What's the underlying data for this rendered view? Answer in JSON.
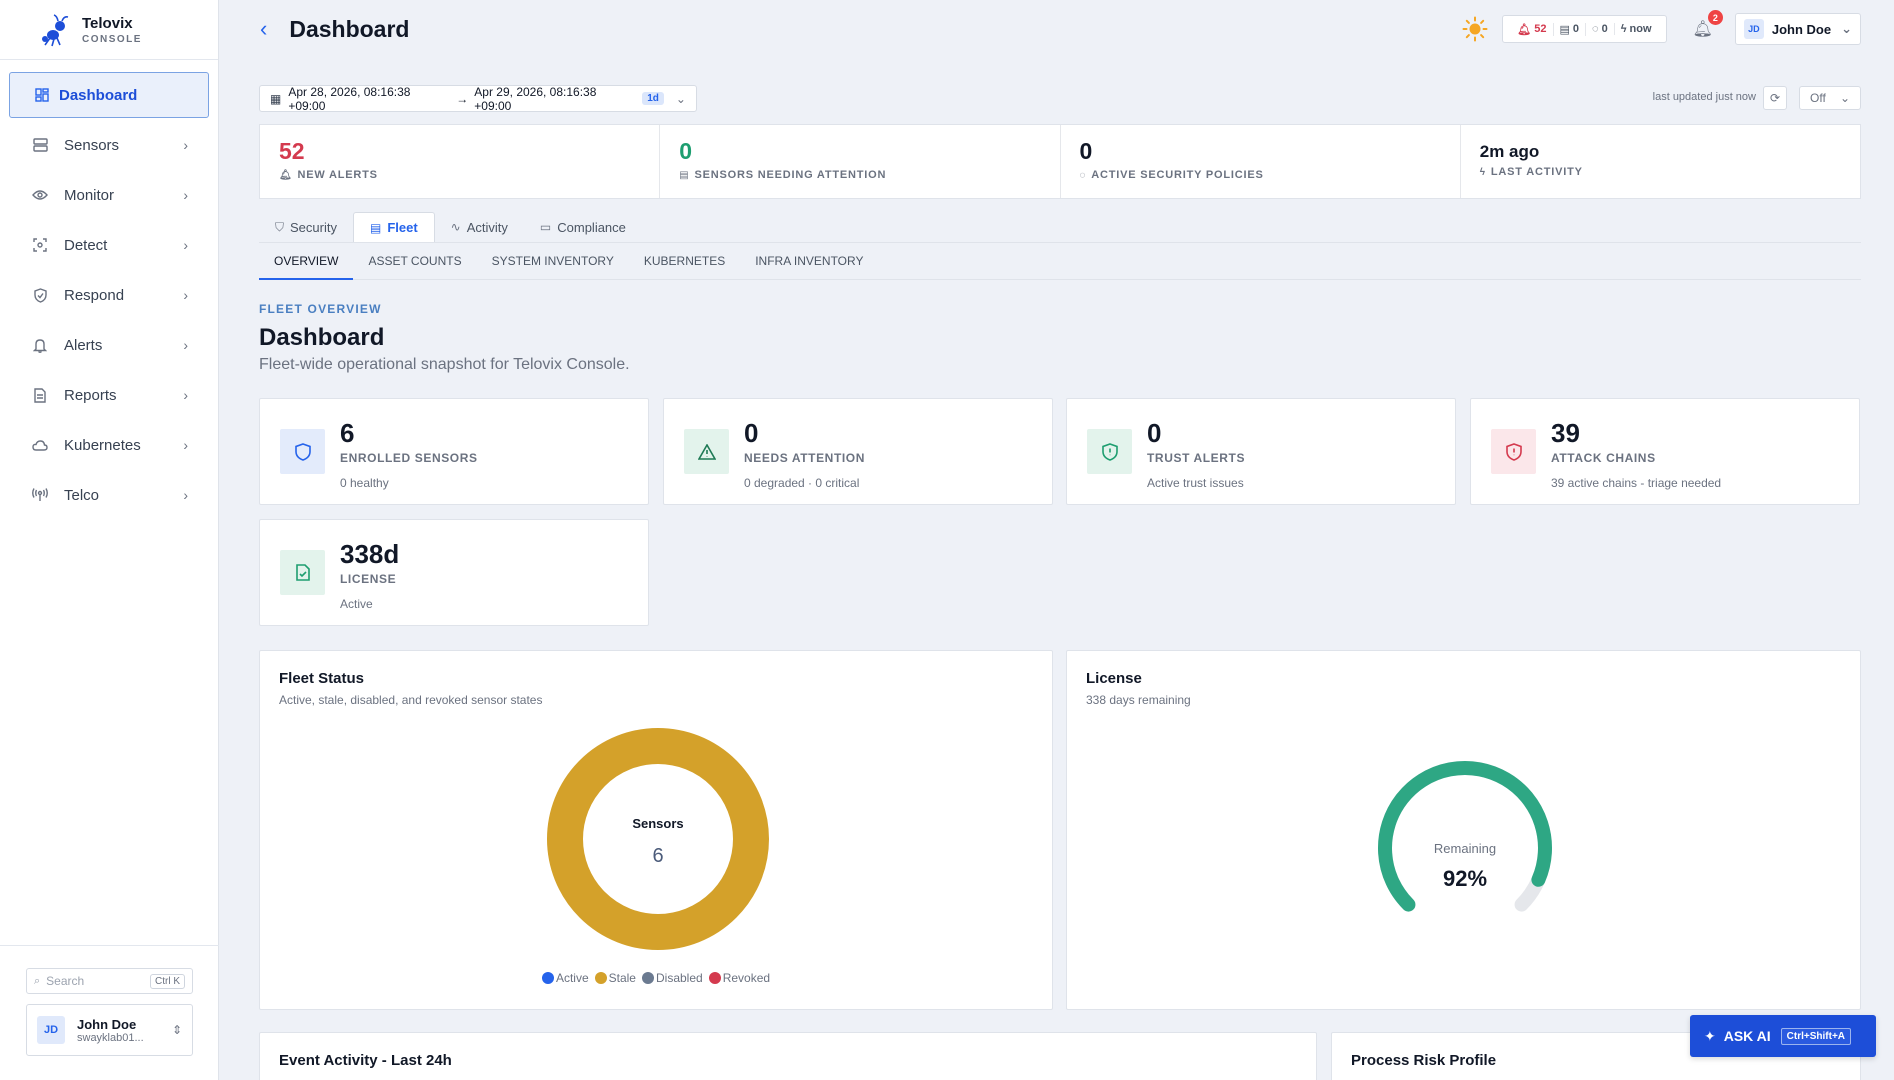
{
  "brand": {
    "name": "Telovix",
    "sub": "CONSOLE"
  },
  "sidebar": {
    "items": [
      {
        "label": "Dashboard",
        "icon": "grid-icon"
      },
      {
        "label": "Sensors",
        "icon": "server-icon"
      },
      {
        "label": "Monitor",
        "icon": "eye-icon"
      },
      {
        "label": "Detect",
        "icon": "scan-icon"
      },
      {
        "label": "Respond",
        "icon": "shield-icon"
      },
      {
        "label": "Alerts",
        "icon": "bell-icon"
      },
      {
        "label": "Reports",
        "icon": "document-icon"
      },
      {
        "label": "Kubernetes",
        "icon": "cloud-icon"
      },
      {
        "label": "Telco",
        "icon": "antenna-icon"
      }
    ],
    "search_placeholder": "Search",
    "search_shortcut": "Ctrl K",
    "user": {
      "initials": "JD",
      "name": "John Doe",
      "org": "swayklab01..."
    }
  },
  "header": {
    "title": "Dashboard",
    "status": {
      "alerts": "52",
      "sensors": "0",
      "policies": "0",
      "activity": "now"
    },
    "notifications_count": "2",
    "user": {
      "initials": "JD",
      "name": "John Doe"
    }
  },
  "daterange": {
    "start": "Apr 28, 2026, 08:16:38 +09:00",
    "end": "Apr 29, 2026, 08:16:38 +09:00",
    "span": "1d",
    "last_updated": "last updated just now",
    "refresh_interval": "Off"
  },
  "stats": [
    {
      "value": "52",
      "label": "NEW ALERTS"
    },
    {
      "value": "0",
      "label": "SENSORS NEEDING ATTENTION"
    },
    {
      "value": "0",
      "label": "ACTIVE SECURITY POLICIES"
    },
    {
      "value": "2m ago",
      "label": "LAST ACTIVITY"
    }
  ],
  "tabs": [
    "Security",
    "Fleet",
    "Activity",
    "Compliance"
  ],
  "subtabs": [
    "OVERVIEW",
    "ASSET COUNTS",
    "SYSTEM INVENTORY",
    "KUBERNETES",
    "INFRA INVENTORY"
  ],
  "section": {
    "kicker": "FLEET OVERVIEW",
    "title": "Dashboard",
    "subtitle": "Fleet-wide operational snapshot for Telovix Console."
  },
  "kpis": [
    {
      "value": "6",
      "label": "ENROLLED SENSORS",
      "sub": "0 healthy"
    },
    {
      "value": "0",
      "label": "NEEDS ATTENTION",
      "sub": "0 degraded · 0 critical"
    },
    {
      "value": "0",
      "label": "TRUST ALERTS",
      "sub": "Active trust issues"
    },
    {
      "value": "39",
      "label": "ATTACK CHAINS",
      "sub": "39 active chains - triage needed"
    },
    {
      "value": "338d",
      "label": "LICENSE",
      "sub": "Active"
    }
  ],
  "fleet_status": {
    "title": "Fleet Status",
    "subtitle": "Active, stale, disabled, and revoked sensor states",
    "center_label": "Sensors",
    "center_value": "6",
    "legend": [
      "Active",
      "Stale",
      "Disabled",
      "Revoked"
    ],
    "colors": {
      "Active": "#2563eb",
      "Stale": "#d4a12a",
      "Disabled": "#6b7a90",
      "Revoked": "#d43a4e"
    }
  },
  "license_panel": {
    "title": "License",
    "subtitle": "338 days remaining",
    "gauge_label": "Remaining",
    "gauge_value": "92%",
    "gauge_fraction": 0.92
  },
  "lower_panels": {
    "event_activity": "Event Activity - Last 24h",
    "process_risk": "Process Risk Profile"
  },
  "ask_ai": {
    "label": "ASK AI",
    "shortcut": "Ctrl+Shift+A"
  }
}
